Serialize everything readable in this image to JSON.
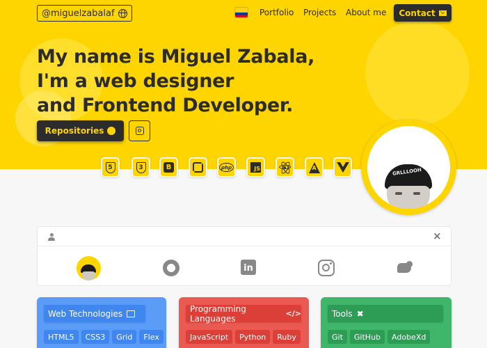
{
  "nav": {
    "brand": "@miguelzabalaf",
    "links": [
      "Portfolio",
      "Projects",
      "About me"
    ],
    "contact": "Contact"
  },
  "hero": {
    "headline": [
      "My name is Miguel Zabala,",
      "I'm a web designer",
      "and Frontend Developer."
    ],
    "repositories_button": "Repositories"
  },
  "technologies": [
    "html5-icon",
    "css3-icon",
    "bootstrap-icon",
    "python-icon",
    "php-icon",
    "javascript-icon",
    "react-icon",
    "angular-icon",
    "vue-icon"
  ],
  "tech_glyphs": {
    "html": "5",
    "css": "3",
    "bootstrap": "B",
    "php": "php",
    "js": "JS"
  },
  "profile": {
    "cap_text": "GRLLLOOH"
  },
  "social": [
    "github-icon",
    "linkedin-icon",
    "instagram-icon",
    "twitter-icon"
  ],
  "social_glyphs": {
    "linkedin": "in"
  },
  "cards": {
    "web": {
      "title": "Web Technologies",
      "tags": [
        "HTML5",
        "CSS3",
        "Grid",
        "Flex"
      ]
    },
    "programming": {
      "title": "Programming Languages",
      "tags": [
        "JavaScript",
        "Python",
        "Ruby"
      ]
    },
    "tools": {
      "title": "Tools",
      "tags": [
        "Git",
        "GitHub",
        "AdobeXd"
      ]
    }
  },
  "colors": {
    "accent": "#ffd500",
    "dark": "#2c2c2c",
    "web": "#5a9cf8",
    "programming": "#eb5a52",
    "tools": "#40b66a"
  }
}
